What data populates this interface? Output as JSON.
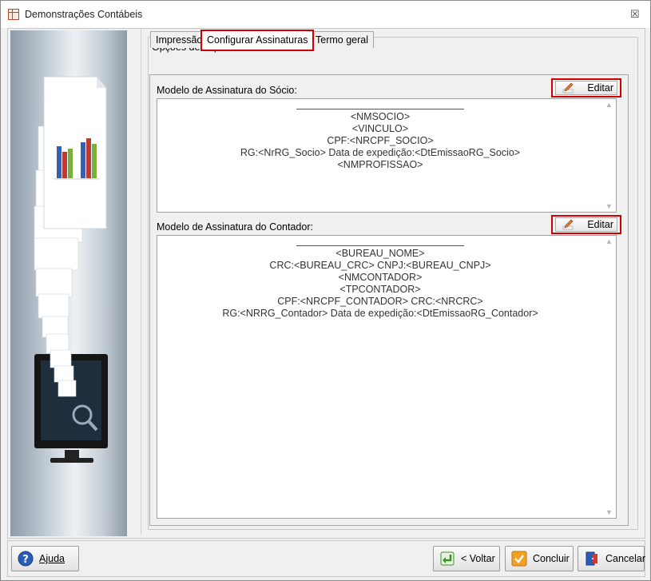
{
  "window": {
    "title": "Demonstrações Contábeis",
    "close": "☒"
  },
  "group": {
    "label": "Opções de Impressão"
  },
  "tabs": [
    {
      "label": "Impressão"
    },
    {
      "label": "Configurar Assinaturas"
    },
    {
      "label": "Termo geral"
    }
  ],
  "socio": {
    "label": "Modelo de Assinatura do Sócio:",
    "edit": "Editar",
    "lines": [
      "<NMSOCIO>",
      "<VINCULO>",
      "CPF:<NRCPF_SOCIO>",
      "RG:<NrRG_Socio> Data de expedição:<DtEmissaoRG_Socio>",
      "<NMPROFISSAO>"
    ]
  },
  "contador": {
    "label": "Modelo de Assinatura do Contador:",
    "edit": "Editar",
    "lines": [
      "<BUREAU_NOME>",
      "CRC:<BUREAU_CRC>  CNPJ:<BUREAU_CNPJ>",
      "<NMCONTADOR>",
      "<TPCONTADOR>",
      "CPF:<NRCPF_CONTADOR>  CRC:<NRCRC>",
      "RG:<NRRG_Contador> Data de expedição:<DtEmissaoRG_Contador>"
    ]
  },
  "footer": {
    "help": "Ajuda",
    "back": "< Voltar",
    "finish": "Concluir",
    "cancel": "Cancelar"
  }
}
